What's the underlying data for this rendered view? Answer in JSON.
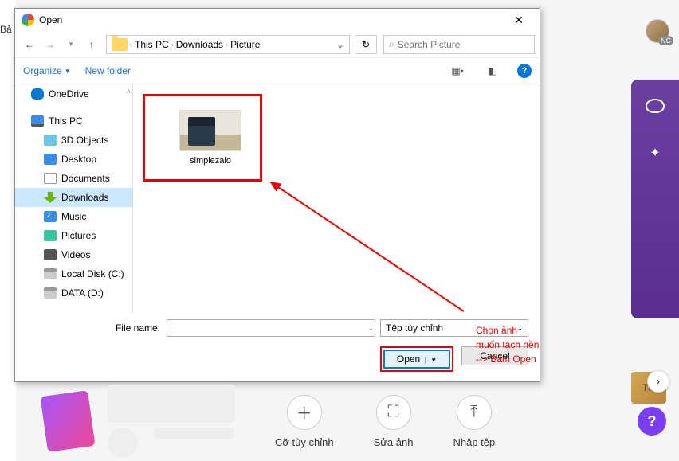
{
  "background": {
    "left_text": "Bả",
    "avatar_initials": "NC",
    "bottom_actions": [
      {
        "icon": "＋",
        "label": "Cỡ tùy chỉnh"
      },
      {
        "icon": "⛶",
        "label": "Sửa ảnh"
      },
      {
        "icon": "⤒",
        "label": "Nhập tệp"
      }
    ],
    "gold_text": "TH",
    "help": "?"
  },
  "dialog": {
    "title": "Open",
    "breadcrumb": [
      "This PC",
      "Downloads",
      "Picture"
    ],
    "search_placeholder": "Search Picture",
    "toolbar": {
      "organize": "Organize",
      "new_folder": "New folder"
    },
    "tree": [
      {
        "name": "OneDrive",
        "icon": "ic-cloud",
        "indent": false,
        "selected": false
      },
      {
        "name": "This PC",
        "icon": "ic-pc",
        "indent": false,
        "selected": false
      },
      {
        "name": "3D Objects",
        "icon": "ic-3d",
        "indent": true,
        "selected": false
      },
      {
        "name": "Desktop",
        "icon": "ic-desktop",
        "indent": true,
        "selected": false
      },
      {
        "name": "Documents",
        "icon": "ic-docs",
        "indent": true,
        "selected": false
      },
      {
        "name": "Downloads",
        "icon": "ic-down",
        "indent": true,
        "selected": true
      },
      {
        "name": "Music",
        "icon": "ic-music",
        "indent": true,
        "selected": false
      },
      {
        "name": "Pictures",
        "icon": "ic-pics",
        "indent": true,
        "selected": false
      },
      {
        "name": "Videos",
        "icon": "ic-vids",
        "indent": true,
        "selected": false
      },
      {
        "name": "Local Disk (C:)",
        "icon": "ic-disk",
        "indent": true,
        "selected": false
      },
      {
        "name": "DATA (D:)",
        "icon": "ic-disk",
        "indent": true,
        "selected": false
      }
    ],
    "files": [
      {
        "name": "simplezalo"
      }
    ],
    "annotation": {
      "line1": "Chọn ảnh muốn tách nền",
      "line2": "--> Bấm Open"
    },
    "footer": {
      "filename_label": "File name:",
      "filename_value": "",
      "filter": "Tệp tùy chỉnh",
      "open": "Open",
      "cancel": "Cancel"
    }
  }
}
